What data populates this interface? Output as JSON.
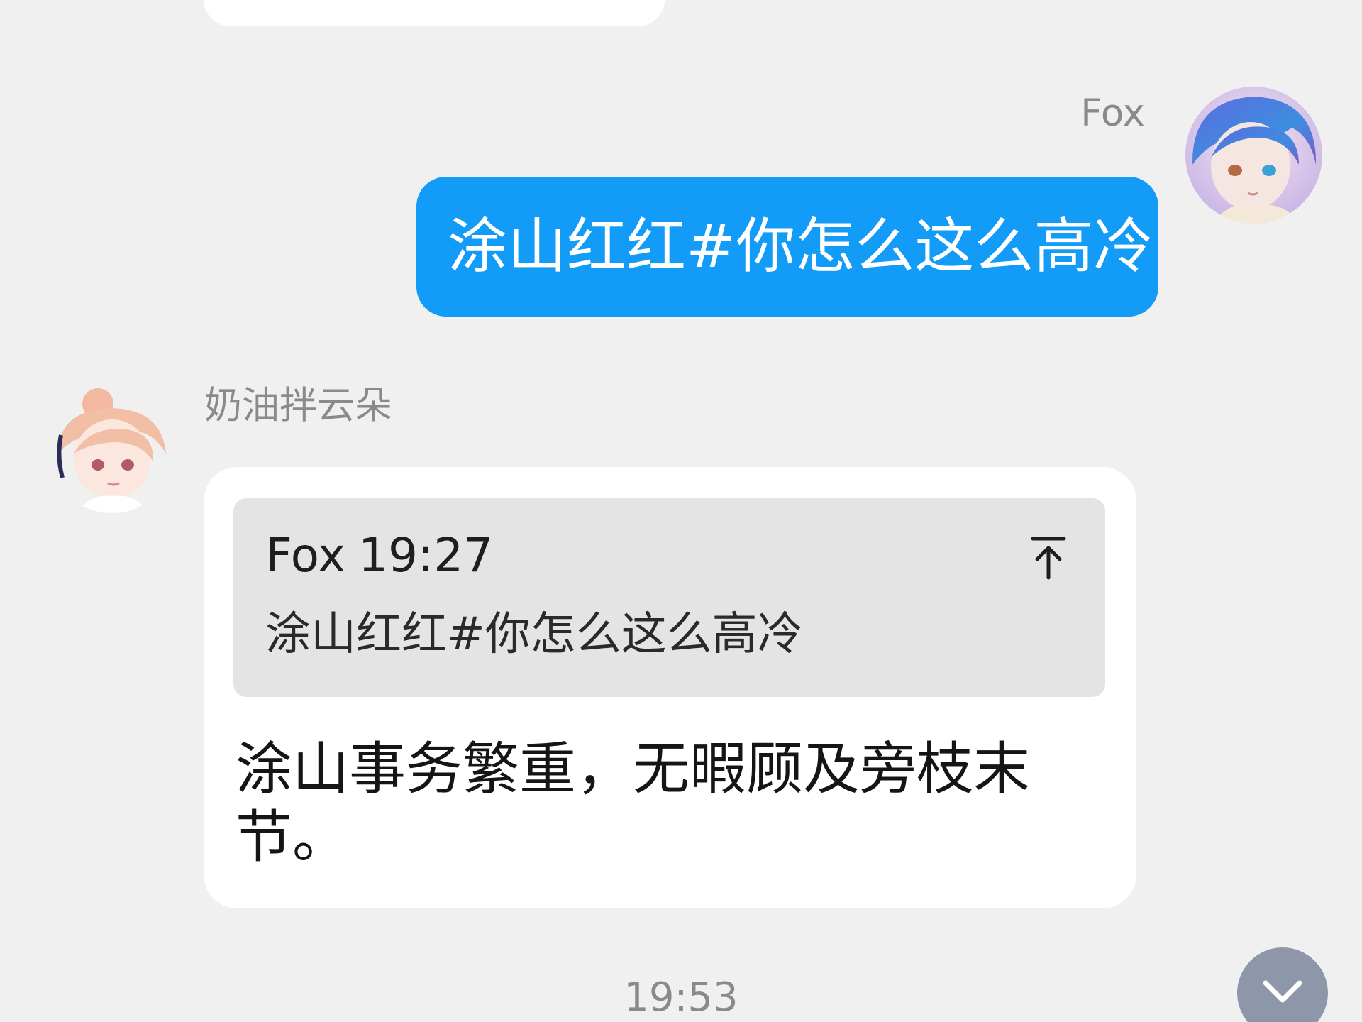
{
  "messages": {
    "outgoing": {
      "sender": "Fox",
      "text": "涂山红红#你怎么这么高冷",
      "bubble_color": "#129bf7"
    },
    "incoming": {
      "sender": "奶油拌云朵",
      "quote": {
        "author": "Fox",
        "time": "19:27",
        "text": "涂山红红#你怎么这么高冷"
      },
      "text": "涂山事务繁重，无暇顾及旁枝末节。"
    }
  },
  "timestamp": "19:53",
  "icons": {
    "jump_to_quote": "arrow-up-to-line-icon",
    "scroll_down": "chevron-down-icon"
  },
  "colors": {
    "background": "#f0f0f0",
    "scroll_button": "#8e97aa"
  }
}
